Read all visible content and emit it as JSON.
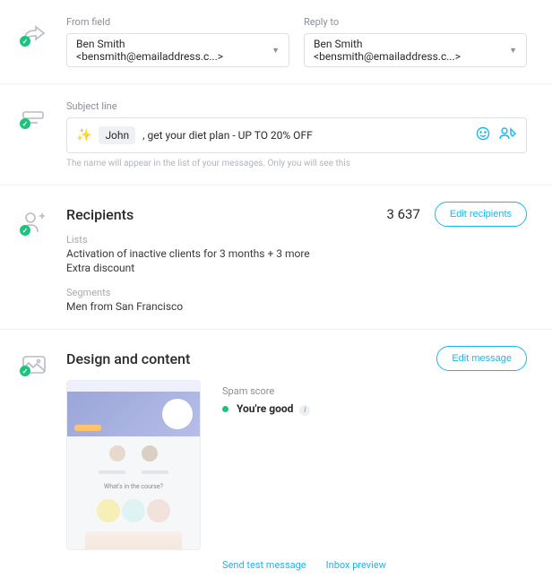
{
  "from": {
    "label": "From field",
    "value": "Ben Smith <bensmith@emailaddress.c...>"
  },
  "replyTo": {
    "label": "Reply to",
    "value": "Ben Smith <bensmith@emailaddress.c...>"
  },
  "subject": {
    "label": "Subject line",
    "chip": "John",
    "text": ", get your diet plan - UP TO 20% OFF",
    "hint": "The name will appear in the list of your messages. Only you will see this"
  },
  "recipients": {
    "title": "Recipients",
    "count": "3 637",
    "editBtn": "Edit recipients",
    "listsLabel": "Lists",
    "list1": "Activation of inactive clients for 3 months + 3 more",
    "list2": "Extra discount",
    "segmentsLabel": "Segments",
    "segment1": "Men from San Francisco"
  },
  "design": {
    "title": "Design and content",
    "editBtn": "Edit message",
    "spamLabel": "Spam score",
    "spamStatus": "You're good",
    "sendTest": "Send test message",
    "inboxPreview": "Inbox preview"
  }
}
